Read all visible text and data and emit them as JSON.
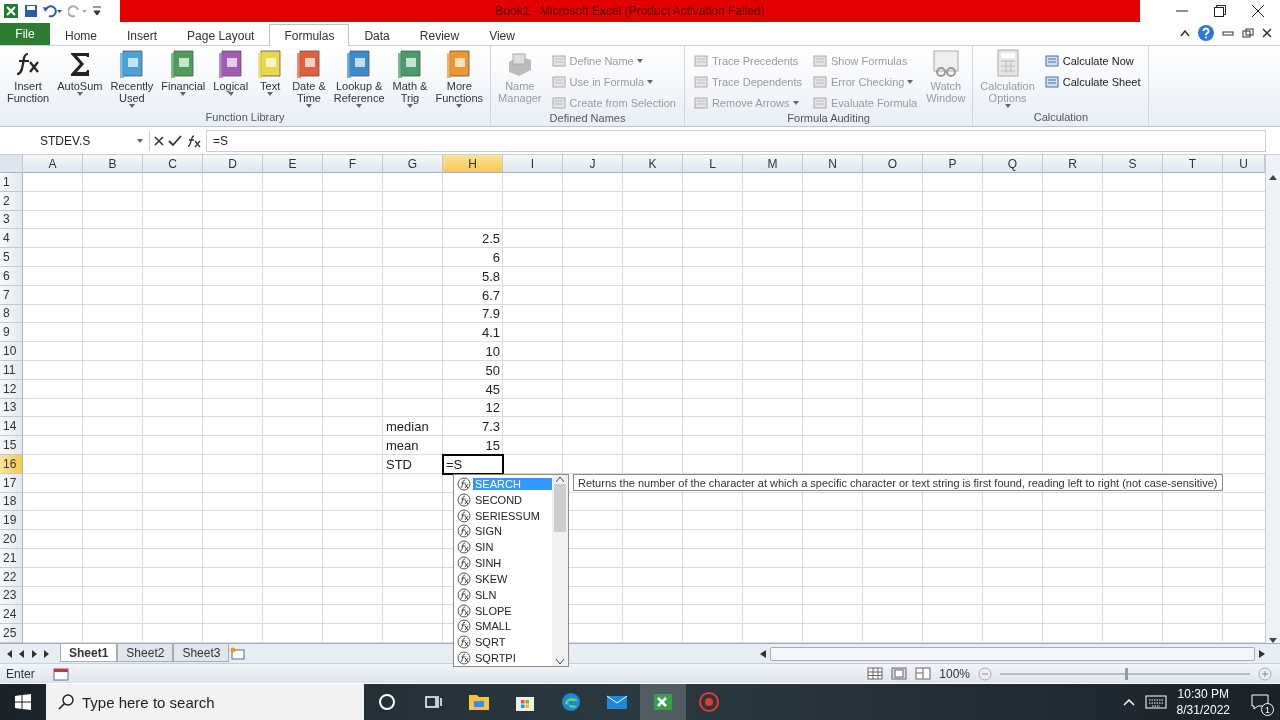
{
  "title_bar": {
    "title": "Book1  -  Microsoft Excel (Product Activation Failed)"
  },
  "ribbon": {
    "file_tab": "File",
    "tabs": [
      {
        "label": "Home",
        "selected": false
      },
      {
        "label": "Insert",
        "selected": false
      },
      {
        "label": "Page Layout",
        "selected": false
      },
      {
        "label": "Formulas",
        "selected": true
      },
      {
        "label": "Data",
        "selected": false
      },
      {
        "label": "Review",
        "selected": false
      },
      {
        "label": "View",
        "selected": false
      }
    ],
    "groups": [
      {
        "label": "Function Library",
        "items": [
          {
            "kind": "fx",
            "label": "Insert\nFunction",
            "disabled": false,
            "menu": false
          },
          {
            "kind": "sum",
            "label": "AutoSum",
            "disabled": false,
            "menu": true
          },
          {
            "kind": "book",
            "label": "Recently\nUsed",
            "disabled": false,
            "menu": true,
            "color": "#4aa3d8"
          },
          {
            "kind": "book",
            "label": "Financial",
            "disabled": false,
            "menu": true,
            "color": "#4c9e5a"
          },
          {
            "kind": "book",
            "label": "Logical",
            "disabled": false,
            "menu": true,
            "color": "#a35bb5"
          },
          {
            "kind": "book",
            "label": "Text",
            "disabled": false,
            "menu": true,
            "color": "#e8d84a"
          },
          {
            "kind": "book",
            "label": "Date &\nTime",
            "disabled": false,
            "menu": true,
            "color": "#e0603a"
          },
          {
            "kind": "book",
            "label": "Lookup &\nReference",
            "disabled": false,
            "menu": true,
            "color": "#3c8ccc"
          },
          {
            "kind": "book",
            "label": "Math &\nTrig",
            "disabled": false,
            "menu": true,
            "color": "#4a9a6a"
          },
          {
            "kind": "book",
            "label": "More\nFunctions",
            "disabled": false,
            "menu": true,
            "color": "#f0962e"
          }
        ]
      },
      {
        "label": "Defined Names",
        "items": [
          {
            "kind": "names",
            "label": "Name\nManager",
            "disabled": true,
            "menu": false
          },
          {
            "kind": "small",
            "label": "Define Name",
            "disabled": true,
            "menu": true
          },
          {
            "kind": "small",
            "label": "Use in Formula",
            "disabled": true,
            "menu": true
          },
          {
            "kind": "small",
            "label": "Create from Selection",
            "disabled": true,
            "menu": false
          }
        ]
      },
      {
        "label": "Formula Auditing",
        "items": [
          {
            "kind": "small",
            "label": "Trace Precedents",
            "disabled": true,
            "menu": false
          },
          {
            "kind": "small",
            "label": "Trace Dependents",
            "disabled": true,
            "menu": false
          },
          {
            "kind": "small",
            "label": "Remove Arrows",
            "disabled": true,
            "menu": true
          },
          {
            "kind": "small",
            "label": "Show Formulas",
            "disabled": true,
            "menu": false
          },
          {
            "kind": "small",
            "label": "Error Checking",
            "disabled": true,
            "menu": true
          },
          {
            "kind": "small",
            "label": "Evaluate Formula",
            "disabled": true,
            "menu": false
          },
          {
            "kind": "watch",
            "label": "Watch\nWindow",
            "disabled": true,
            "menu": false
          }
        ]
      },
      {
        "label": "Calculation",
        "items": [
          {
            "kind": "calc",
            "label": "Calculation\nOptions",
            "disabled": true,
            "menu": true
          },
          {
            "kind": "small",
            "label": "Calculate Now",
            "disabled": false,
            "menu": false
          },
          {
            "kind": "small",
            "label": "Calculate Sheet",
            "disabled": false,
            "menu": false
          }
        ]
      }
    ]
  },
  "formula_bar": {
    "name_box": "STDEV.S",
    "formula": "=S"
  },
  "sheet": {
    "columns": [
      {
        "label": "A",
        "selected": false
      },
      {
        "label": "B",
        "selected": false
      },
      {
        "label": "C",
        "selected": false
      },
      {
        "label": "D",
        "selected": false
      },
      {
        "label": "E",
        "selected": false
      },
      {
        "label": "F",
        "selected": false
      },
      {
        "label": "G",
        "selected": false
      },
      {
        "label": "H",
        "selected": true
      },
      {
        "label": "I",
        "selected": false
      },
      {
        "label": "J",
        "selected": false
      },
      {
        "label": "K",
        "selected": false
      },
      {
        "label": "L",
        "selected": false
      },
      {
        "label": "M",
        "selected": false
      },
      {
        "label": "N",
        "selected": false
      },
      {
        "label": "O",
        "selected": false
      },
      {
        "label": "P",
        "selected": false
      },
      {
        "label": "Q",
        "selected": false
      },
      {
        "label": "R",
        "selected": false
      },
      {
        "label": "S",
        "selected": false
      },
      {
        "label": "T",
        "selected": false
      },
      {
        "label": "U",
        "selected": false
      }
    ],
    "rows": [
      {
        "header": "1",
        "selected": false
      },
      {
        "header": "2",
        "selected": false
      },
      {
        "header": "3",
        "selected": false
      },
      {
        "header": "4",
        "selected": false,
        "column_h": "2.5"
      },
      {
        "header": "5",
        "selected": false,
        "column_h": "6"
      },
      {
        "header": "6",
        "selected": false,
        "column_h": "5.8"
      },
      {
        "header": "7",
        "selected": false,
        "column_h": "6.7"
      },
      {
        "header": "8",
        "selected": false,
        "column_h": "7.9"
      },
      {
        "header": "9",
        "selected": false,
        "column_h": "4.1"
      },
      {
        "header": "10",
        "selected": false,
        "column_h": "10"
      },
      {
        "header": "11",
        "selected": false,
        "column_h": "50"
      },
      {
        "header": "12",
        "selected": false,
        "column_h": "45"
      },
      {
        "header": "13",
        "selected": false,
        "column_h": "12"
      },
      {
        "header": "14",
        "selected": false,
        "column_g": "median",
        "column_h": "7.3"
      },
      {
        "header": "15",
        "selected": false,
        "column_g": "mean",
        "column_h": "15"
      },
      {
        "header": "16",
        "selected": true,
        "column_g": "STD",
        "column_h": "=S"
      },
      {
        "header": "17",
        "selected": false
      },
      {
        "header": "18",
        "selected": false
      },
      {
        "header": "19",
        "selected": false
      },
      {
        "header": "20",
        "selected": false
      },
      {
        "header": "21",
        "selected": false
      },
      {
        "header": "22",
        "selected": false
      },
      {
        "header": "23",
        "selected": false
      },
      {
        "header": "24",
        "selected": false
      },
      {
        "header": "25",
        "selected": false
      }
    ]
  },
  "autocomplete": {
    "items": [
      {
        "label": "SEARCH",
        "selected": true
      },
      {
        "label": "SECOND",
        "selected": false
      },
      {
        "label": "SERIESSUM",
        "selected": false
      },
      {
        "label": "SIGN",
        "selected": false
      },
      {
        "label": "SIN",
        "selected": false
      },
      {
        "label": "SINH",
        "selected": false
      },
      {
        "label": "SKEW",
        "selected": false
      },
      {
        "label": "SLN",
        "selected": false
      },
      {
        "label": "SLOPE",
        "selected": false
      },
      {
        "label": "SMALL",
        "selected": false
      },
      {
        "label": "SQRT",
        "selected": false
      },
      {
        "label": "SQRTPI",
        "selected": false
      }
    ],
    "tooltip": "Returns the number of the character at which a specific character or text string is first found, reading left to right (not case-sensitive)"
  },
  "sheet_tabs": [
    {
      "label": "Sheet1",
      "selected": true
    },
    {
      "label": "Sheet2",
      "selected": false
    },
    {
      "label": "Sheet3",
      "selected": false
    }
  ],
  "status_bar": {
    "mode": "Enter",
    "zoom": "100%",
    "zoom_slider": {
      "level": 0.5
    }
  },
  "taskbar": {
    "search_placeholder": "Type here to search",
    "time": "10:30 PM",
    "date": "8/31/2022",
    "notifications": "1"
  }
}
